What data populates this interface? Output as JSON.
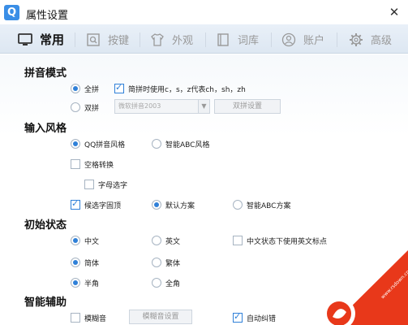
{
  "window": {
    "title": "属性设置",
    "logo_letter": "Q",
    "close_icon": "✕"
  },
  "tabs": [
    {
      "label": "常用",
      "icon": "monitor-icon",
      "active": true
    },
    {
      "label": "按键",
      "icon": "keyboard-icon",
      "active": false
    },
    {
      "label": "外观",
      "icon": "shirt-icon",
      "active": false
    },
    {
      "label": "词库",
      "icon": "book-icon",
      "active": false
    },
    {
      "label": "账户",
      "icon": "user-icon",
      "active": false
    },
    {
      "label": "高级",
      "icon": "gear-icon",
      "active": false
    }
  ],
  "pinyin_mode": {
    "title": "拼音模式",
    "quanpin_label": "全拼",
    "simplified_check_label": "简拼时使用c，s，z代表ch，sh，zh",
    "shuangpin_label": "双拼",
    "shuangpin_select_value": "微软拼音2003",
    "shuangpin_settings_label": "双拼设置"
  },
  "input_style": {
    "title": "输入风格",
    "qq_style_label": "QQ拼音风格",
    "abc_style_label": "智能ABC风格",
    "space_convert_label": "空格转换",
    "letter_select_label": "字母选字",
    "fixed_top_label": "候选字固顶",
    "default_scheme_label": "默认方案",
    "abc_scheme_label": "智能ABC方案"
  },
  "initial_state": {
    "title": "初始状态",
    "chinese_label": "中文",
    "english_label": "英文",
    "english_punct_label": "中文状态下使用英文标点",
    "simplified_label": "简体",
    "traditional_label": "繁体",
    "halfwidth_label": "半角",
    "fullwidth_label": "全角"
  },
  "smart_assist": {
    "title": "智能辅助",
    "fuzzy_label": "模糊音",
    "fuzzy_settings_label": "模糊音设置",
    "auto_correct_label": "自动纠错"
  },
  "colors": {
    "accent": "#2f80d8",
    "watermark": "#e8381a"
  }
}
